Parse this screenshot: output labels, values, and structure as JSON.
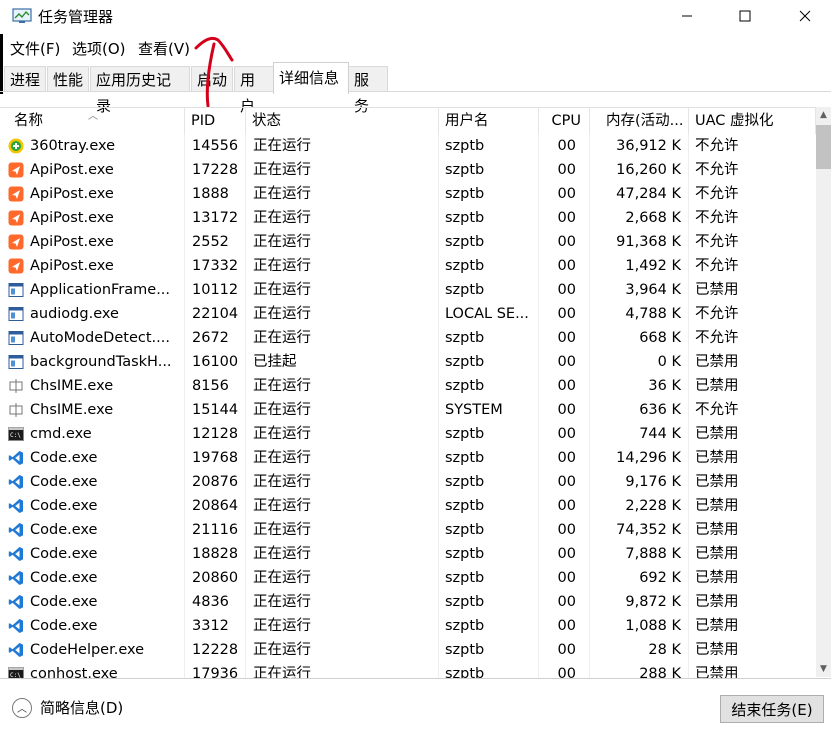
{
  "window": {
    "title": "任务管理器"
  },
  "menu": [
    "文件(F)",
    "选项(O)",
    "查看(V)"
  ],
  "tabs": [
    "进程",
    "性能",
    "应用历史记录",
    "启动",
    "用户",
    "详细信息",
    "服务"
  ],
  "active_tab": "详细信息",
  "columns": [
    "名称",
    "PID",
    "状态",
    "用户名",
    "CPU",
    "内存(活动...",
    "UAC 虚拟化"
  ],
  "rows": [
    {
      "icon": "360tray-icon",
      "name": "360tray.exe",
      "pid": "14556",
      "status": "正在运行",
      "user": "szptb",
      "cpu": "00",
      "mem": "36,912 K",
      "uac": "不允许"
    },
    {
      "icon": "apipost-icon",
      "name": "ApiPost.exe",
      "pid": "17228",
      "status": "正在运行",
      "user": "szptb",
      "cpu": "00",
      "mem": "16,260 K",
      "uac": "不允许"
    },
    {
      "icon": "apipost-icon",
      "name": "ApiPost.exe",
      "pid": "1888",
      "status": "正在运行",
      "user": "szptb",
      "cpu": "00",
      "mem": "47,284 K",
      "uac": "不允许"
    },
    {
      "icon": "apipost-icon",
      "name": "ApiPost.exe",
      "pid": "13172",
      "status": "正在运行",
      "user": "szptb",
      "cpu": "00",
      "mem": "2,668 K",
      "uac": "不允许"
    },
    {
      "icon": "apipost-icon",
      "name": "ApiPost.exe",
      "pid": "2552",
      "status": "正在运行",
      "user": "szptb",
      "cpu": "00",
      "mem": "91,368 K",
      "uac": "不允许"
    },
    {
      "icon": "apipost-icon",
      "name": "ApiPost.exe",
      "pid": "17332",
      "status": "正在运行",
      "user": "szptb",
      "cpu": "00",
      "mem": "1,492 K",
      "uac": "不允许"
    },
    {
      "icon": "window-app-icon",
      "name": "ApplicationFrame...",
      "pid": "10112",
      "status": "正在运行",
      "user": "szptb",
      "cpu": "00",
      "mem": "3,964 K",
      "uac": "已禁用"
    },
    {
      "icon": "window-app-icon",
      "name": "audiodg.exe",
      "pid": "22104",
      "status": "正在运行",
      "user": "LOCAL SE...",
      "cpu": "00",
      "mem": "4,788 K",
      "uac": "不允许"
    },
    {
      "icon": "window-app-icon",
      "name": "AutoModeDetect....",
      "pid": "2672",
      "status": "正在运行",
      "user": "szptb",
      "cpu": "00",
      "mem": "668 K",
      "uac": "不允许"
    },
    {
      "icon": "window-app-icon",
      "name": "backgroundTaskH...",
      "pid": "16100",
      "status": "已挂起",
      "user": "szptb",
      "cpu": "00",
      "mem": "0 K",
      "uac": "已禁用"
    },
    {
      "icon": "ime-icon",
      "name": "ChsIME.exe",
      "pid": "8156",
      "status": "正在运行",
      "user": "szptb",
      "cpu": "00",
      "mem": "36 K",
      "uac": "已禁用"
    },
    {
      "icon": "ime-icon",
      "name": "ChsIME.exe",
      "pid": "15144",
      "status": "正在运行",
      "user": "SYSTEM",
      "cpu": "00",
      "mem": "636 K",
      "uac": "不允许"
    },
    {
      "icon": "cmd-icon",
      "name": "cmd.exe",
      "pid": "12128",
      "status": "正在运行",
      "user": "szptb",
      "cpu": "00",
      "mem": "744 K",
      "uac": "已禁用"
    },
    {
      "icon": "vscode-icon",
      "name": "Code.exe",
      "pid": "19768",
      "status": "正在运行",
      "user": "szptb",
      "cpu": "00",
      "mem": "14,296 K",
      "uac": "已禁用"
    },
    {
      "icon": "vscode-icon",
      "name": "Code.exe",
      "pid": "20876",
      "status": "正在运行",
      "user": "szptb",
      "cpu": "00",
      "mem": "9,176 K",
      "uac": "已禁用"
    },
    {
      "icon": "vscode-icon",
      "name": "Code.exe",
      "pid": "20864",
      "status": "正在运行",
      "user": "szptb",
      "cpu": "00",
      "mem": "2,228 K",
      "uac": "已禁用"
    },
    {
      "icon": "vscode-icon",
      "name": "Code.exe",
      "pid": "21116",
      "status": "正在运行",
      "user": "szptb",
      "cpu": "00",
      "mem": "74,352 K",
      "uac": "已禁用"
    },
    {
      "icon": "vscode-icon",
      "name": "Code.exe",
      "pid": "18828",
      "status": "正在运行",
      "user": "szptb",
      "cpu": "00",
      "mem": "7,888 K",
      "uac": "已禁用"
    },
    {
      "icon": "vscode-icon",
      "name": "Code.exe",
      "pid": "20860",
      "status": "正在运行",
      "user": "szptb",
      "cpu": "00",
      "mem": "692 K",
      "uac": "已禁用"
    },
    {
      "icon": "vscode-icon",
      "name": "Code.exe",
      "pid": "4836",
      "status": "正在运行",
      "user": "szptb",
      "cpu": "00",
      "mem": "9,872 K",
      "uac": "已禁用"
    },
    {
      "icon": "vscode-icon",
      "name": "Code.exe",
      "pid": "3312",
      "status": "正在运行",
      "user": "szptb",
      "cpu": "00",
      "mem": "1,088 K",
      "uac": "已禁用"
    },
    {
      "icon": "vscode-icon",
      "name": "CodeHelper.exe",
      "pid": "12228",
      "status": "正在运行",
      "user": "szptb",
      "cpu": "00",
      "mem": "28 K",
      "uac": "已禁用"
    },
    {
      "icon": "cmd-icon",
      "name": "conhost.exe",
      "pid": "17936",
      "status": "正在运行",
      "user": "szptb",
      "cpu": "00",
      "mem": "288 K",
      "uac": "已禁用"
    }
  ],
  "footer": {
    "fewer_details": "简略信息(D)",
    "end_task": "结束任务(E)"
  },
  "colors": {
    "apipost": "#ff6a2c",
    "vscode": "#1f7ad6",
    "360": "#2aa63a",
    "accent": "#0078d7"
  }
}
